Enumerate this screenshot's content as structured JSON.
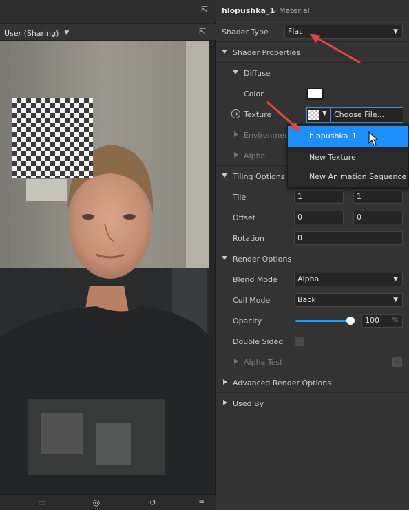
{
  "viewport": {
    "camera_select": "User (Sharing)",
    "icons": {
      "popout_left": "external-window-icon",
      "popout_right": "external-window-icon",
      "camera": "video-camera-icon",
      "capture": "screenshot-icon",
      "rotate": "rotate-device-icon",
      "menu": "hamburger-menu-icon"
    }
  },
  "inspector": {
    "title": "hlopushka_1",
    "subtitle": "– Material",
    "shader_type": {
      "label": "Shader Type",
      "value": "Flat"
    },
    "shader_properties": {
      "label": "Shader Properties",
      "diffuse": {
        "label": "Diffuse",
        "color_label": "Color",
        "color_value": "#ffffff",
        "texture_label": "Texture",
        "texture_button": "Choose File..."
      },
      "environment_label": "Environment",
      "alpha_label": "Alpha"
    },
    "tiling_options": {
      "label": "Tiling Options",
      "tile_label": "Tile",
      "tile_x": "1",
      "tile_y": "1",
      "offset_label": "Offset",
      "offset_x": "0",
      "offset_y": "0",
      "rotation_label": "Rotation",
      "rotation_value": "0"
    },
    "render_options": {
      "label": "Render Options",
      "blend_mode_label": "Blend Mode",
      "blend_mode_value": "Alpha",
      "cull_mode_label": "Cull Mode",
      "cull_mode_value": "Back",
      "opacity_label": "Opacity",
      "opacity_value": "100",
      "opacity_unit": "%",
      "opacity_fraction": 1.0,
      "double_sided_label": "Double Sided",
      "alpha_test_label": "Alpha Test"
    },
    "advanced_render_options_label": "Advanced Render Options",
    "used_by_label": "Used By"
  },
  "texture_menu": {
    "items": [
      "hlopushka_1",
      "New Texture",
      "New Animation Sequence"
    ],
    "selected_index": 0
  },
  "colors": {
    "accent": "#1e8fff",
    "annotation_arrow": "#e8433c",
    "panel_bg": "#333333"
  }
}
